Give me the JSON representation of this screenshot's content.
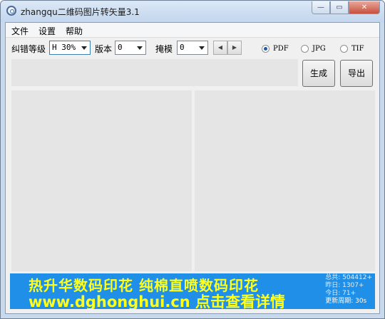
{
  "window": {
    "title": "zhangqu二维码图片转矢量3.1",
    "min_symbol": "—",
    "max_symbol": "▭",
    "close_symbol": "✕"
  },
  "menu": [
    "文件",
    "设置",
    "帮助"
  ],
  "controls": {
    "error_level_label": "纠错等级",
    "error_level_value": "H 30%",
    "version_label": "版本",
    "version_value": "0",
    "mask_label": "掩模",
    "mask_value": "0",
    "spin_left": "◀",
    "spin_right": "▶",
    "formats": [
      {
        "label": "PDF",
        "selected": true
      },
      {
        "label": "JPG",
        "selected": false
      },
      {
        "label": "TIF",
        "selected": false
      }
    ]
  },
  "buttons": {
    "generate": "生成",
    "export": "导出"
  },
  "banner": {
    "line1": "热升华数码印花 纯棉直喷数码印花",
    "line2": "www.dghonghui.cn 点击查看详情",
    "stats": [
      "总共: 504412+",
      "昨日: 1307+",
      "今日: 71+",
      "更新周期: 30s"
    ],
    "bg_color": "#1f8fe8",
    "text_color": "#ffff1a"
  }
}
